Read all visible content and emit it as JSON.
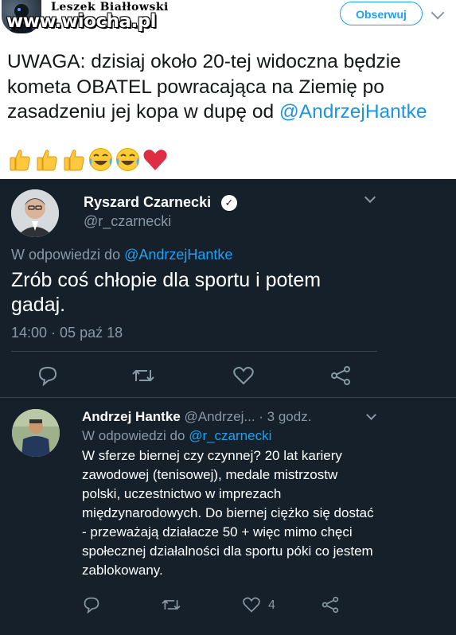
{
  "header": {
    "author_name": "Leszek Białłowski",
    "watermark": "www.wiocha.pl",
    "follow_label": "Obserwuj"
  },
  "tweet": {
    "text_before": "UWAGA: dzisiaj około 20-tej widoczna będzie kometa OBATEL powracająca na Ziemię po zasadzeniu jej kopa w dupę od ",
    "mention": "@AndrzejHantke",
    "emojis": [
      "thumbs-up",
      "thumbs-up",
      "thumbs-up",
      "tears-of-joy",
      "tears-of-joy",
      "red-heart"
    ]
  },
  "embedded": {
    "tweet1": {
      "name": "Ryszard Czarnecki",
      "handle": "@r_czarnecki",
      "reply_prefix": "W odpowiedzi do ",
      "reply_to": "@AndrzejHantke",
      "text": "Zrób coś chłopie dla sportu i potem gadaj.",
      "time": "14:00 · 05 paź 18"
    },
    "tweet2": {
      "name": "Andrzej Hantke",
      "handle_time": " @Andrzej... · 3 godz.",
      "reply_prefix": "W odpowiedzi do ",
      "reply_to": "@r_czarnecki",
      "text": "W sferze biernej czy czynnej? 20 lat kariery zawodowej (tenisowej), medale mistrzostw polski, uczestnictwo w imprezach międzynarodowych. Do biernej ciężko się dostać - przeważają działacze 50 + więc mimo chęci społecznej działalności dla sportu póki co jestem zablokowany.",
      "like_count": "4"
    }
  },
  "colors": {
    "dark_bg": "#15202b",
    "accent": "#1da1f2",
    "muted": "#8899a6"
  }
}
